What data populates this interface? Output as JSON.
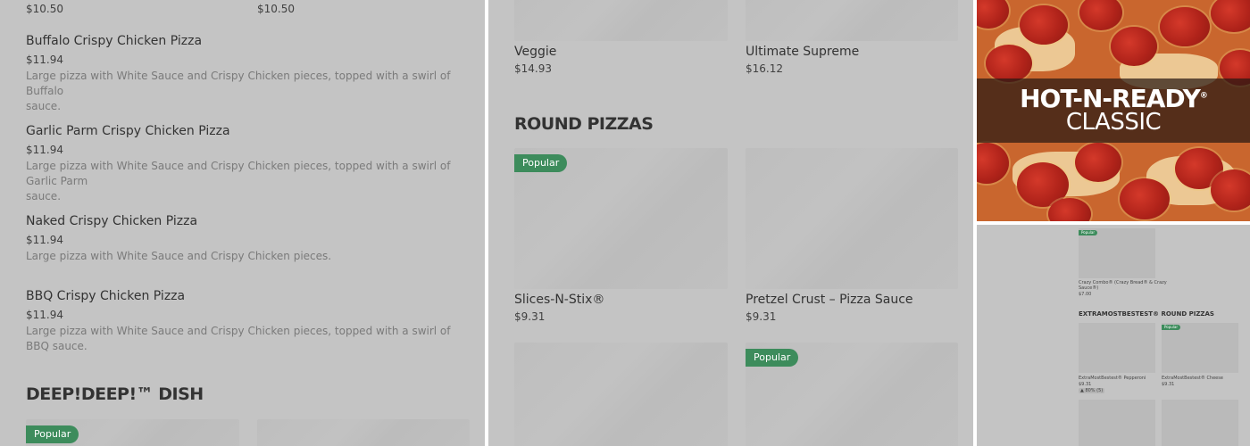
{
  "left": {
    "top_prices": [
      "$10.50",
      "$10.50"
    ],
    "items": [
      {
        "title": "Buffalo Crispy Chicken Pizza",
        "price": "$11.94",
        "desc_line1": "Large pizza with White Sauce and Crispy Chicken pieces, topped with a swirl of Buffalo",
        "desc_line2": "sauce."
      },
      {
        "title": "Garlic Parm Crispy Chicken Pizza",
        "price": "$11.94",
        "desc_line1": "Large pizza with White Sauce and Crispy Chicken pieces, topped with a swirl of Garlic Parm",
        "desc_line2": "sauce."
      },
      {
        "title": "Naked Crispy Chicken Pizza",
        "price": "$11.94",
        "desc_line1": "Large pizza with White Sauce and Crispy Chicken pieces.",
        "desc_line2": ""
      },
      {
        "title": "BBQ Crispy Chicken Pizza",
        "price": "$11.94",
        "desc_line1": "Large pizza with White Sauce and Crispy Chicken pieces, topped with a swirl of BBQ sauce.",
        "desc_line2": ""
      }
    ],
    "section_title": "DEEP!DEEP!™ DISH",
    "badge": "Popular"
  },
  "middle": {
    "top_items": [
      {
        "title": "Veggie",
        "price": "$14.93"
      },
      {
        "title": "Ultimate Supreme",
        "price": "$16.12"
      }
    ],
    "section_title": "ROUND PIZZAS",
    "round_items": [
      {
        "title": "Slices-N-Stix®",
        "price": "$9.31",
        "badge": "Popular"
      },
      {
        "title": "Pretzel Crust – Pizza Sauce",
        "price": "$9.31",
        "badge": ""
      }
    ],
    "bottom_badge": "Popular"
  },
  "hero": {
    "line1": "HOT-N-READY",
    "reg": "®",
    "line2": "CLASSIC"
  },
  "thumbnail": {
    "badge": "Popular",
    "combo_title_line1": "Crazy Combo® (Crazy Bread® & Crazy",
    "combo_title_line2": "Sauce®)",
    "combo_price": "$7.00",
    "section_title": "EXTRAMOSTBESTEST® ROUND PIZZAS",
    "items": [
      {
        "title": "ExtraMostBestest® Pepperoni",
        "price": "$9.31",
        "rating": "80% (5)",
        "badge": ""
      },
      {
        "title": "ExtraMostBestest® Cheese",
        "price": "$9.31",
        "rating": "",
        "badge": "Popular"
      }
    ]
  },
  "colors": {
    "overlay_gray": "#c4c4c4",
    "popular_green": "#3d8c5c",
    "pepperoni_red": "#b0231a"
  }
}
